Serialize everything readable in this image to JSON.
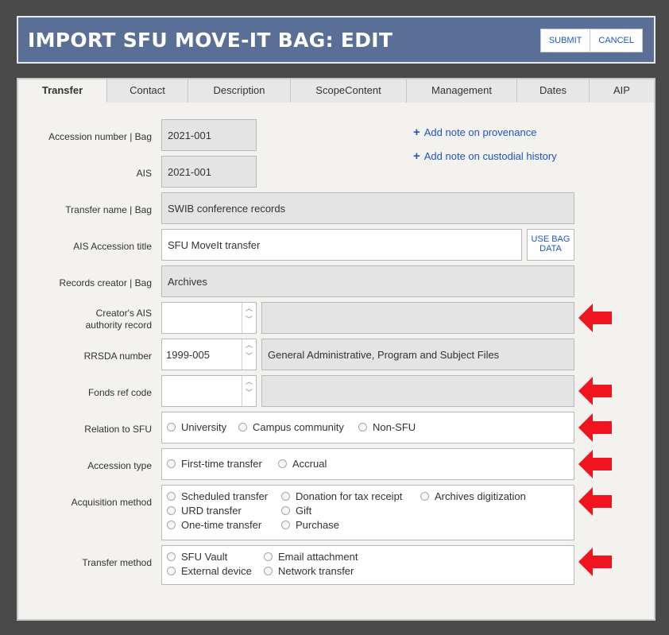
{
  "header": {
    "title": "IMPORT SFU MOVE-IT BAG: EDIT",
    "submit_label": "SUBMIT",
    "cancel_label": "CANCEL"
  },
  "tabs": [
    {
      "label": "Transfer",
      "active": true
    },
    {
      "label": "Contact"
    },
    {
      "label": "Description"
    },
    {
      "label": "ScopeContent"
    },
    {
      "label": "Management"
    },
    {
      "label": "Dates"
    },
    {
      "label": "AIP"
    }
  ],
  "links": {
    "provenance": "Add note on provenance",
    "custodial": "Add note on custodial history"
  },
  "fields": {
    "accession": {
      "label": "Accession number | Bag",
      "value": "2021-001"
    },
    "ais": {
      "label": "AIS",
      "value": "2021-001"
    },
    "transfer_name": {
      "label": "Transfer name | Bag",
      "value": "SWIB conference records"
    },
    "ais_title": {
      "label": "AIS Accession title",
      "value": "SFU MoveIt transfer",
      "button": "USE BAG DATA"
    },
    "records_creator": {
      "label": "Records creator | Bag",
      "value": "Archives"
    },
    "creator_authority": {
      "label_line1": "Creator's AIS",
      "label_line2": "authority record",
      "value": "",
      "text": ""
    },
    "rrsda": {
      "label": "RRSDA number",
      "value": "1999-005",
      "text": "General Administrative, Program and Subject Files"
    },
    "fonds": {
      "label": "Fonds ref code",
      "value": "",
      "text": ""
    },
    "relation": {
      "label": "Relation to SFU",
      "options": [
        "University",
        "Campus community",
        "Non-SFU"
      ]
    },
    "accession_type": {
      "label": "Accession type",
      "options": [
        "First-time transfer",
        "Accrual"
      ]
    },
    "acquisition": {
      "label": "Acquisition method",
      "options": [
        "Scheduled transfer",
        "Donation for tax receipt",
        "Archives digitization",
        "URD transfer",
        "Gift",
        "One-time transfer",
        "Purchase"
      ]
    },
    "transfer_method": {
      "label": "Transfer method",
      "options": [
        "SFU Vault",
        "Email attachment",
        "External device",
        "Network transfer"
      ]
    }
  },
  "colors": {
    "header_bg": "#5a6f96",
    "link": "#1f55c0",
    "arrow": "#f0141e",
    "page_bg": "#4a4a4a",
    "panel_bg": "#f3f2ef"
  },
  "icons": {
    "select_arrow": "chevron-down-icon",
    "add": "plus-icon",
    "marker": "red-arrow-left-icon"
  }
}
